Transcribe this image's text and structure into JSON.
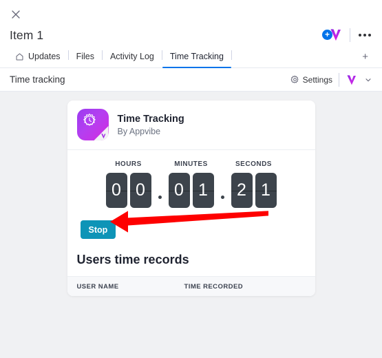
{
  "window": {
    "close_label": "close-icon",
    "item_title": "Item 1"
  },
  "title_actions": {
    "add_app_label": "+",
    "overflow_label": "more-options"
  },
  "tabs": [
    {
      "label": "Updates",
      "icon": "home-icon",
      "active": false
    },
    {
      "label": "Files",
      "icon": "",
      "active": false
    },
    {
      "label": "Activity Log",
      "icon": "",
      "active": false
    },
    {
      "label": "Time Tracking",
      "icon": "",
      "active": true
    }
  ],
  "add_tab_label": "+",
  "subheader": {
    "title": "Time tracking",
    "settings_label": "Settings",
    "settings_icon": "gear-icon",
    "app_logo_icon": "appvibe-heart-icon",
    "chevron_icon": "chevron-down-icon"
  },
  "card": {
    "app_icon": "time-tracking-app-icon",
    "app_name": "Time Tracking",
    "app_author": "By Appvibe"
  },
  "timer": {
    "units": [
      {
        "label": "HOURS",
        "digits": [
          "0",
          "0"
        ]
      },
      {
        "label": "MINUTES",
        "digits": [
          "0",
          "1"
        ]
      },
      {
        "label": "SECONDS",
        "digits": [
          "2",
          "1"
        ]
      }
    ],
    "separator": "•",
    "elapsed": "00:01:21"
  },
  "stop_button": {
    "label": "Stop",
    "color": "#0e94b7"
  },
  "records": {
    "title": "Users time records",
    "columns": [
      "USER NAME",
      "TIME RECORDED"
    ],
    "rows": []
  },
  "annotation": {
    "arrow_color": "#fe0000",
    "arrow_target": "stop-button"
  }
}
